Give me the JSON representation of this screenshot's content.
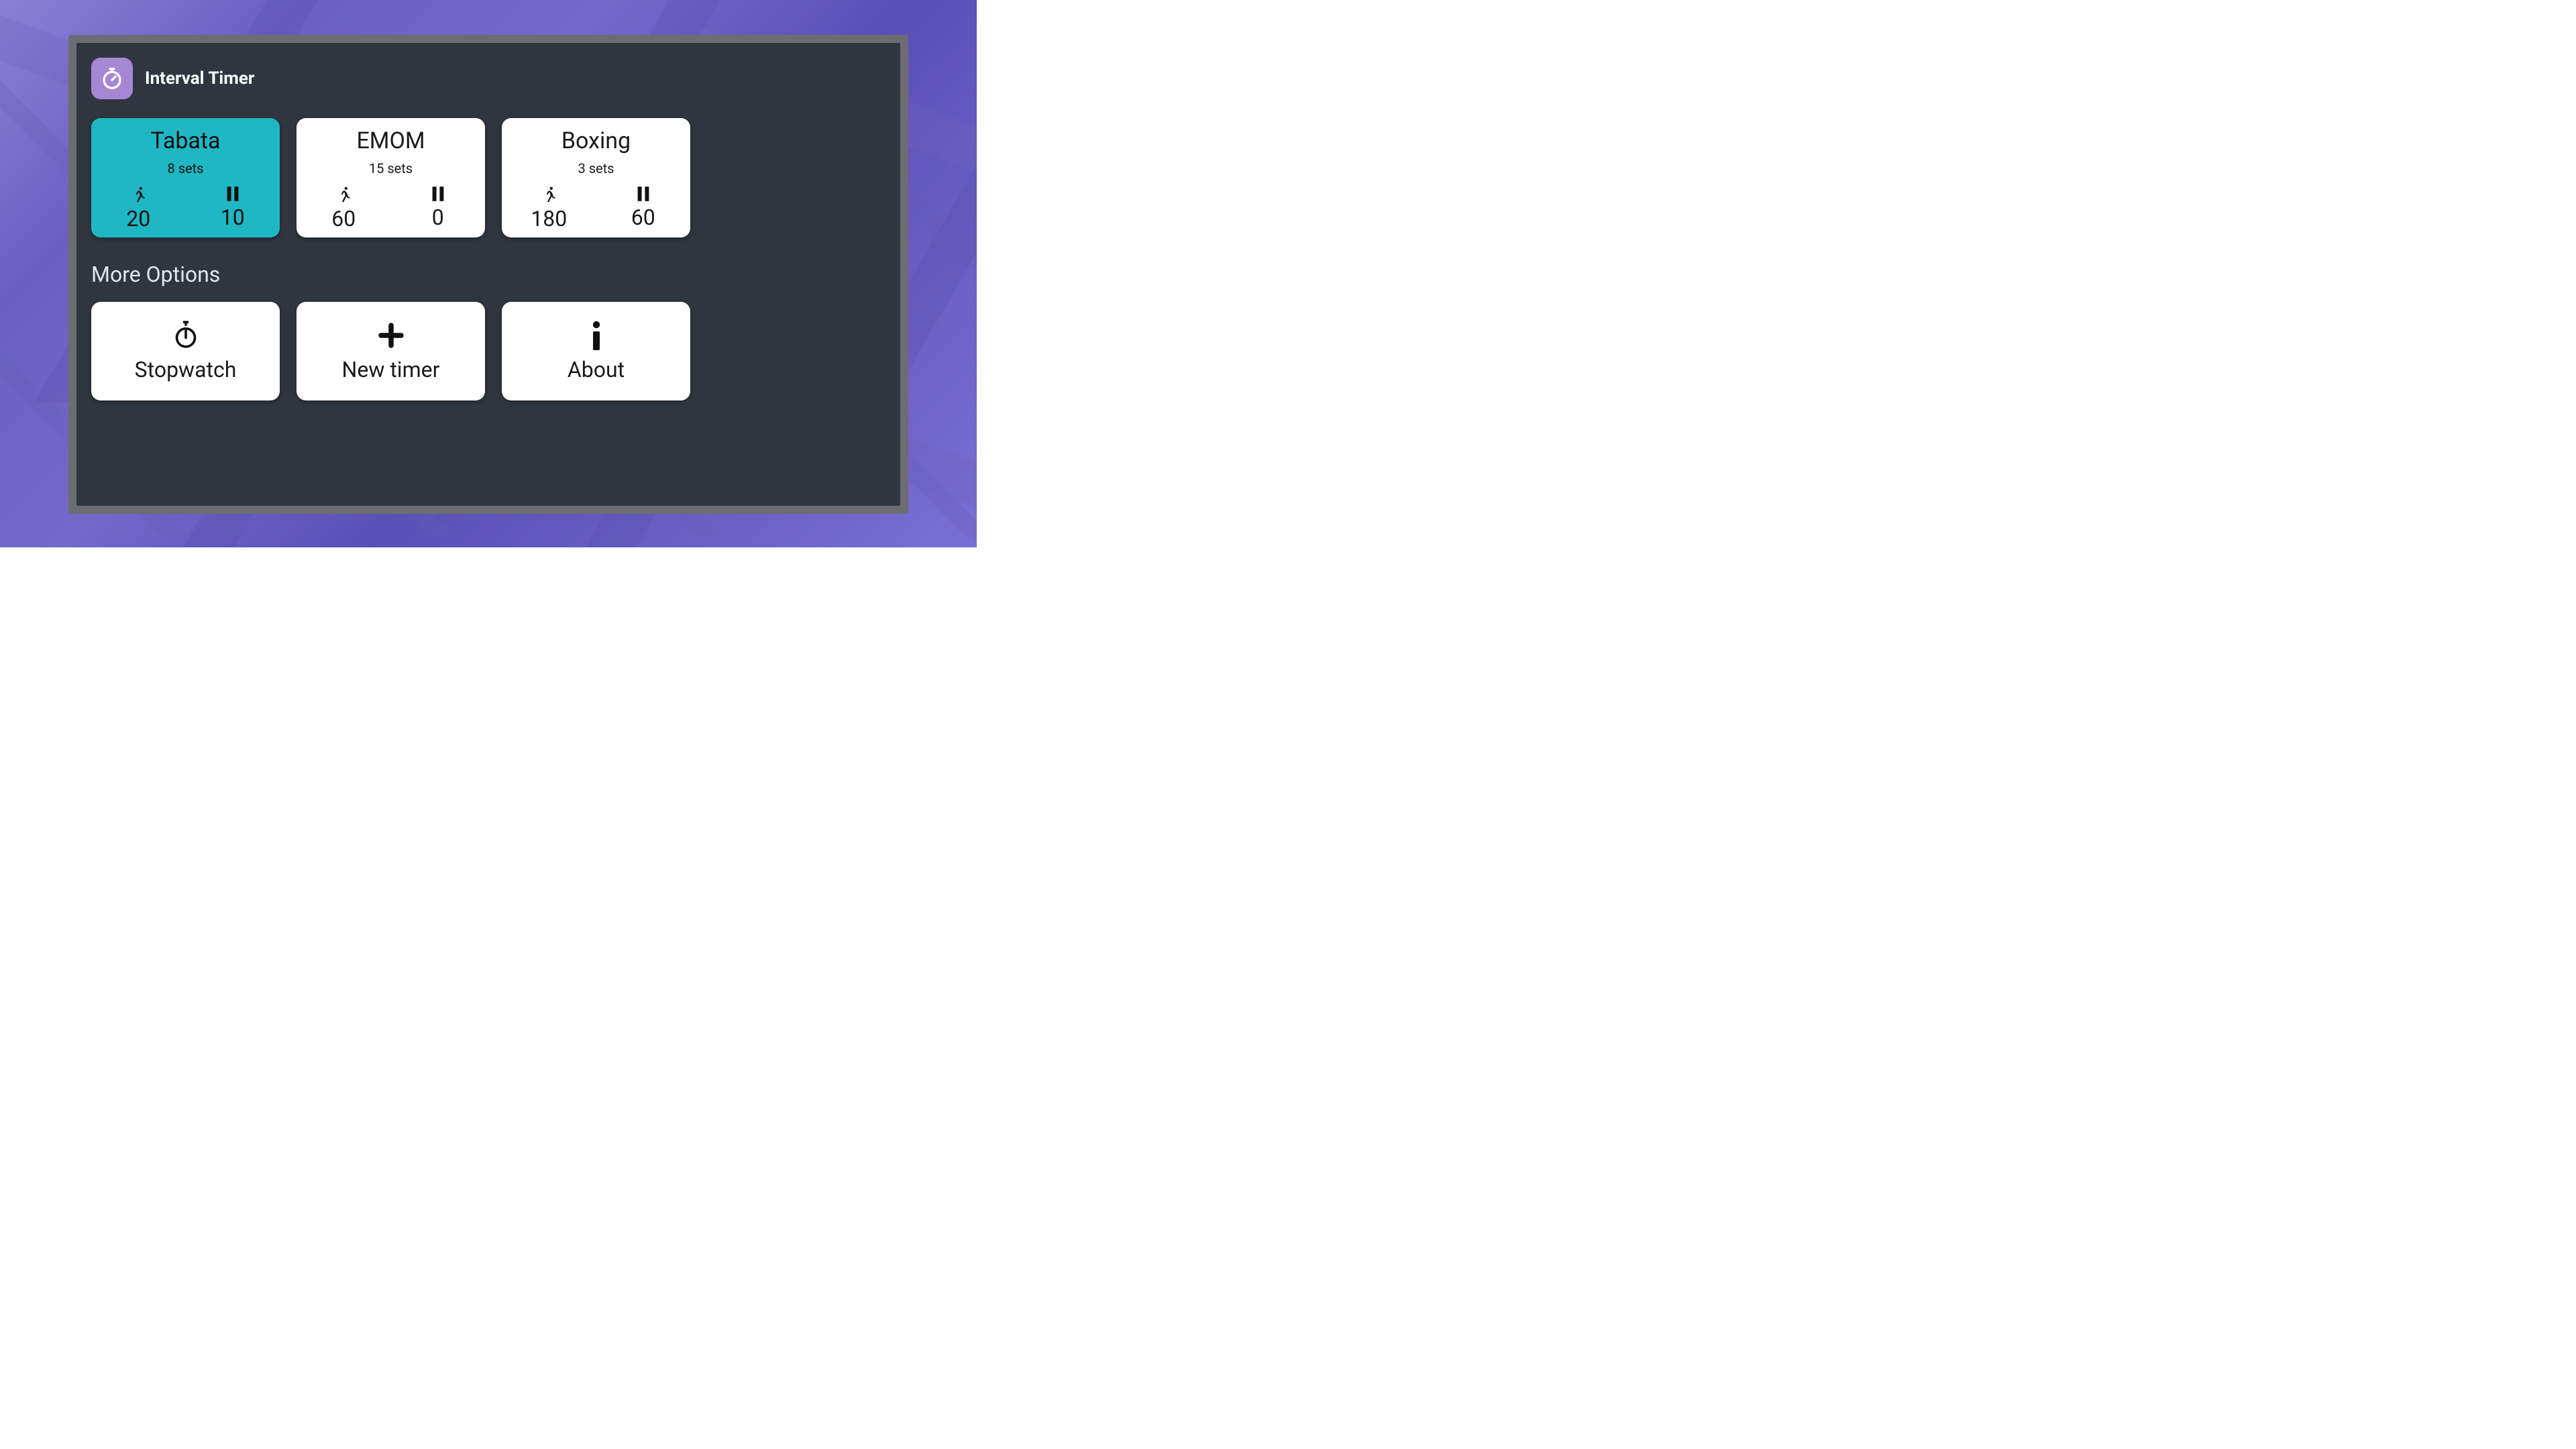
{
  "app": {
    "title": "Interval Timer"
  },
  "presets": [
    {
      "name": "Tabata",
      "sets": "8 sets",
      "work": "20",
      "rest": "10",
      "selected": true
    },
    {
      "name": "EMOM",
      "sets": "15 sets",
      "work": "60",
      "rest": "0",
      "selected": false
    },
    {
      "name": "Boxing",
      "sets": "3 sets",
      "work": "180",
      "rest": "60",
      "selected": false
    }
  ],
  "more_options": {
    "heading": "More Options",
    "items": [
      {
        "label": "Stopwatch",
        "icon": "stopwatch-icon"
      },
      {
        "label": "New timer",
        "icon": "plus-icon"
      },
      {
        "label": "About",
        "icon": "info-icon"
      }
    ]
  },
  "colors": {
    "accent": "#1fb7c3",
    "app_icon_bg": "#a687d4",
    "panel": "#2f3640"
  }
}
